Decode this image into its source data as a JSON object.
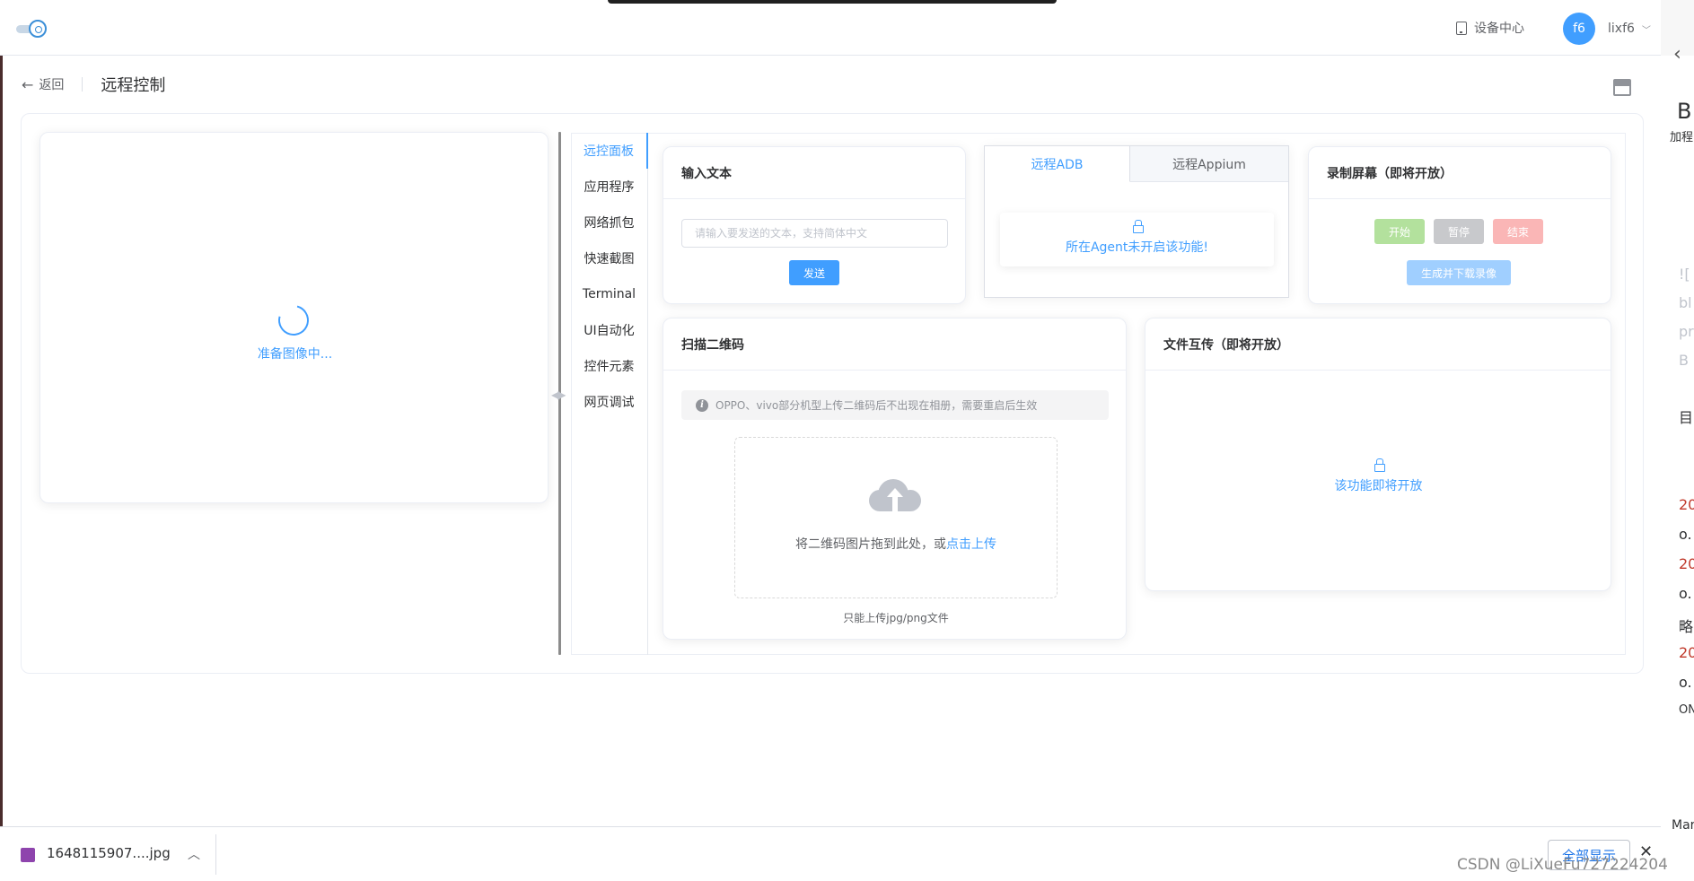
{
  "header": {
    "device_center_label": "设备中心",
    "avatar_text": "f6",
    "username": "lixf6"
  },
  "page_header": {
    "back_label": "返回",
    "title": "远程控制"
  },
  "device": {
    "loading_text": "准备图像中..."
  },
  "vertical_tabs": [
    {
      "label": "远控面板"
    },
    {
      "label": "应用程序"
    },
    {
      "label": "网络抓包"
    },
    {
      "label": "快速截图"
    },
    {
      "label": "Terminal"
    },
    {
      "label": "UI自动化"
    },
    {
      "label": "控件元素"
    },
    {
      "label": "网页调试"
    }
  ],
  "input_text_card": {
    "title": "输入文本",
    "placeholder": "请输入要发送的文本，支持简体中文",
    "send_label": "发送"
  },
  "remote_tabs": {
    "tabs": [
      {
        "label": "远程ADB"
      },
      {
        "label": "远程Appium"
      }
    ],
    "notice": "所在Agent未开启该功能!"
  },
  "record_card": {
    "title": "录制屏幕（即将开放）",
    "start_label": "开始",
    "pause_label": "暂停",
    "stop_label": "结束",
    "download_label": "生成并下载录像",
    "colors": {
      "start": "#b3e19d",
      "pause": "#c8c9cc",
      "stop": "#fab6b6",
      "download": "#a0cfff"
    }
  },
  "qr_card": {
    "title": "扫描二维码",
    "alert": "OPPO、vivo部分机型上传二维码后不出现在相册，需要重启后生效",
    "upload_text": "将二维码图片拖到此处，或",
    "upload_link": "点击上传",
    "upload_tip": "只能上传jpg/png文件"
  },
  "file_card": {
    "title": "文件互传（即将开放）",
    "notice": "该功能即将开放"
  },
  "download_bar": {
    "file_name": "1648115907....jpg",
    "show_all_label": "全部显示"
  },
  "watermark": "CSDN @LiXueFu727224204",
  "right_strip": {
    "lines": [
      "B",
      "加程",
      "![",
      "bl",
      "pr",
      "B",
      "目",
      "20",
      "o.",
      "20",
      "o.",
      "略",
      "20",
      "o.",
      "ON",
      "Mar"
    ]
  },
  "colors": {
    "primary": "#409eff"
  }
}
